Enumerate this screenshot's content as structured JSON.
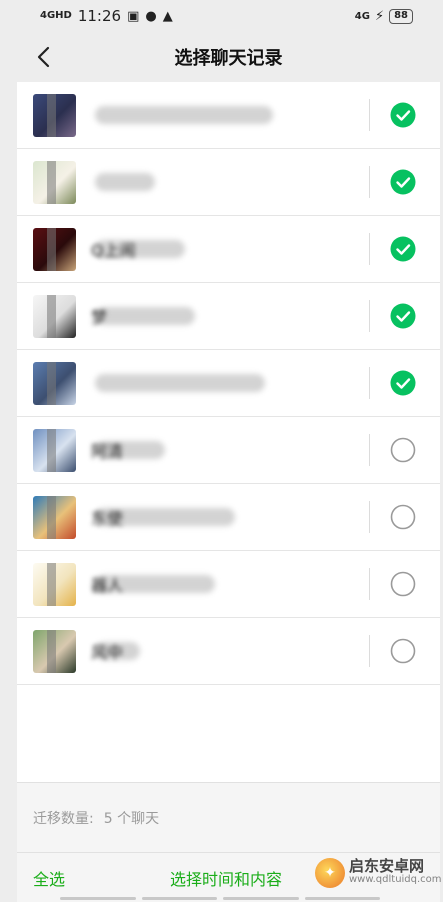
{
  "status_bar": {
    "network": "4GHD",
    "time": "11:26",
    "right_network": "4G",
    "battery": "88",
    "icons": [
      "app-badge-icon",
      "chat-bubble-icon",
      "warning-icon",
      "bolt-icon"
    ]
  },
  "nav": {
    "title": "选择聊天记录",
    "back_icon": "chevron-left-icon"
  },
  "chats": [
    {
      "name": "",
      "selected": true,
      "avatar_colors": [
        "#3b4a7a",
        "#7a6a8a",
        "#2b2f4f"
      ]
    },
    {
      "name": "",
      "selected": true,
      "avatar_colors": [
        "#dbe6cf",
        "#7c8a5a",
        "#f5f1e7"
      ]
    },
    {
      "name": "Q上闹",
      "selected": true,
      "avatar_colors": [
        "#5a0f13",
        "#c9a57a",
        "#2a0a0b"
      ]
    },
    {
      "name": "梦",
      "selected": true,
      "avatar_colors": [
        "#f6f6f6",
        "#222222",
        "#dddddd"
      ]
    },
    {
      "name": "",
      "selected": true,
      "avatar_colors": [
        "#5b7db0",
        "#c8d4e6",
        "#3d4f70"
      ]
    },
    {
      "name": "阿清",
      "selected": false,
      "avatar_colors": [
        "#6f90c0",
        "#3b4e6e",
        "#d8e2ef"
      ]
    },
    {
      "name": "东使",
      "selected": false,
      "avatar_colors": [
        "#2f7bb8",
        "#c24a2a",
        "#e8c17a"
      ]
    },
    {
      "name": "器人",
      "selected": false,
      "avatar_colors": [
        "#fdfbf2",
        "#e4b24a",
        "#f2e4bd"
      ]
    },
    {
      "name": "风中",
      "selected": false,
      "avatar_colors": [
        "#7fa56c",
        "#2b3a2a",
        "#d9c9b0"
      ]
    }
  ],
  "footer": {
    "count_label": "迁移数量:",
    "count_value": "5 个聊天",
    "select_all": "全选",
    "select_time": "选择时间和内容"
  },
  "watermark": {
    "title": "启东安卓网",
    "url": "www.qdltuidq.com"
  },
  "colors": {
    "accent": "#07c160",
    "link_green": "#1aad19",
    "background": "#ededed"
  }
}
